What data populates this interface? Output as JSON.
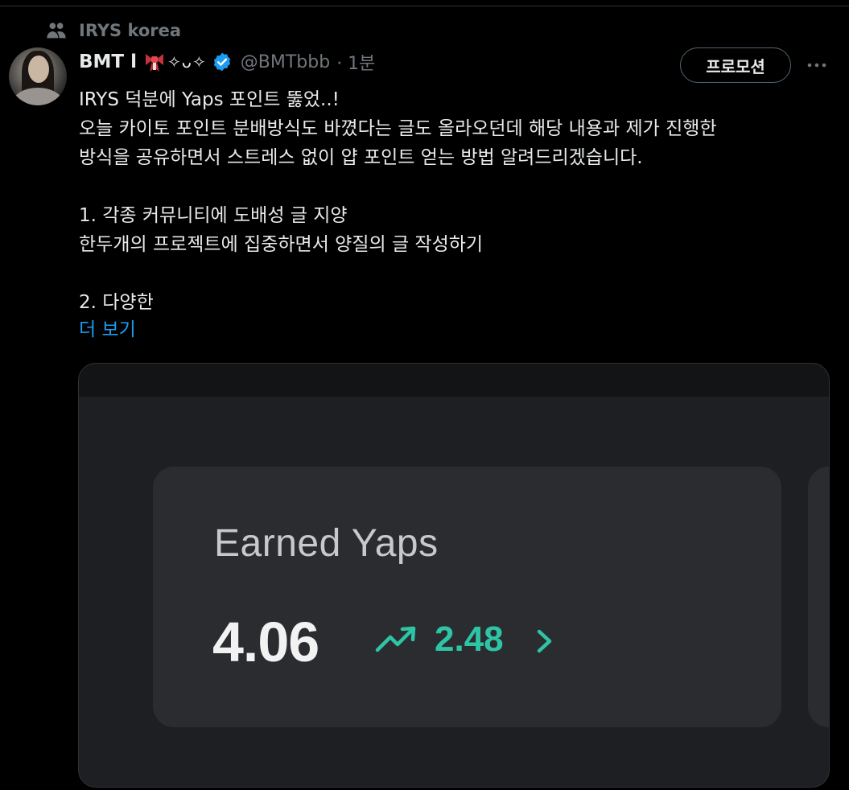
{
  "community": {
    "name": "IRYS korea"
  },
  "author": {
    "display_name": "BMT l",
    "decoration": "✧ᴗ✧",
    "handle": "@BMTbbb",
    "time": "· 1분"
  },
  "actions": {
    "promote_label": "프로모션",
    "more_icon": "ellipsis-icon"
  },
  "tweet": {
    "lines": [
      "IRYS 덕분에 Yaps 포인트 뚫었..!",
      "오늘 카이토 포인트 분배방식도 바꼈다는 글도 올라오던데 해당 내용과 제가 진행한",
      "방식을 공유하면서 스트레스 없이 얍 포인트 얻는 방법 알려드리겠습니다.",
      "",
      "1. 각종 커뮤니티에 도배성 글 지양",
      "한두개의 프로젝트에 집중하면서 양질의 글 작성하기",
      "",
      "2. 다양한"
    ],
    "show_more": "더 보기"
  },
  "media": {
    "stat_title": "Earned Yaps",
    "stat_value": "4.06",
    "stat_delta": "2.48"
  },
  "colors": {
    "background": "#000000",
    "link": "#1d9bf0",
    "verified": "#1d9bf0",
    "trend": "#2ec4a6",
    "muted": "#71767b"
  }
}
